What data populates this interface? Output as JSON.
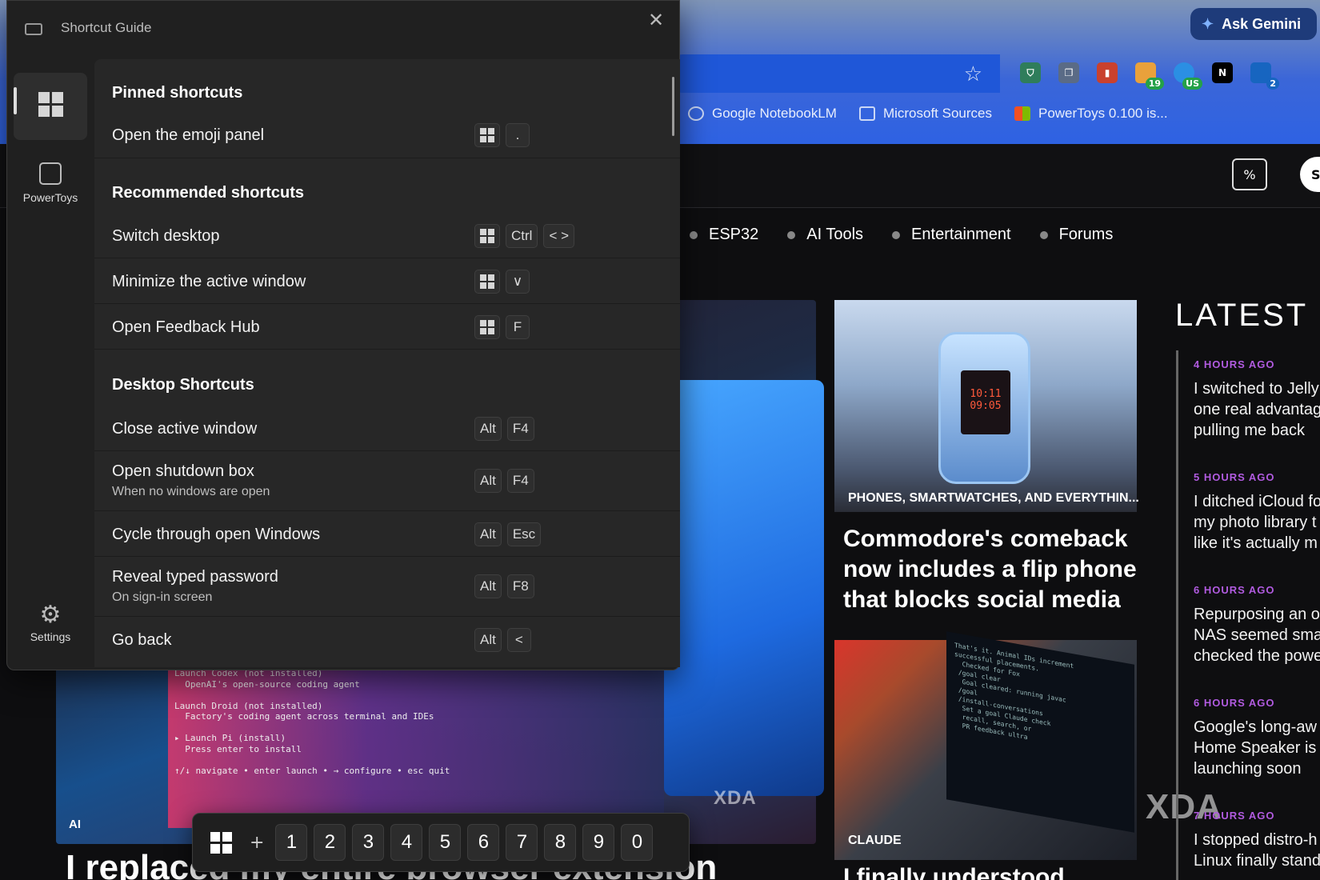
{
  "browser": {
    "ask_gemini": "Ask Gemini",
    "bookmarks": [
      "Google NotebookLM",
      "Microsoft Sources",
      "PowerToys 0.100 is..."
    ],
    "extension_badges": [
      "19",
      "US",
      "N",
      "2"
    ]
  },
  "site": {
    "nav": [
      "ESP32",
      "AI Tools",
      "Entertainment",
      "Forums"
    ],
    "signin_partial": "Si",
    "hero_tag": "AI",
    "hero_headline": "I replaced my entire browser extension",
    "terminal_lines": "Launch Codex (not installed)\n  OpenAI's open-source coding agent\n\nLaunch Droid (not installed)\n  Factory's coding agent across terminal and IDEs\n\n▸ Launch Pi (install)\n  Press enter to install\n\n↑/↓ navigate • enter launch • → configure • esc quit",
    "watermark": "XDA",
    "card1": {
      "tag": "PHONES, SMARTWATCHES, AND EVERYTHIN...",
      "title": "Commodore's comeback now includes a flip phone that blocks social media",
      "screen_text": "10:11 09:05"
    },
    "card2": {
      "tag": "CLAUDE",
      "title": "I finally understood"
    },
    "latest": {
      "title": "LATEST",
      "items": [
        {
          "time": "4 HOURS AGO",
          "text": "I switched to Jelly\none real advantag\npulling me back"
        },
        {
          "time": "5 HOURS AGO",
          "text": "I ditched iCloud fo\nmy photo library t\nlike it's actually m"
        },
        {
          "time": "6 HOURS AGO",
          "text": "Repurposing an o\nNAS seemed sma\nchecked the powe"
        },
        {
          "time": "6 HOURS AGO",
          "text": "Google's long-aw\nHome Speaker is\nlaunching soon"
        },
        {
          "time": "7 HOURS AGO",
          "text": "I stopped distro-h\nLinux finally stand"
        }
      ]
    }
  },
  "guide": {
    "title": "Shortcut Guide",
    "rail": {
      "powertoys": "PowerToys",
      "settings": "Settings"
    },
    "sections": {
      "pinned": "Pinned shortcuts",
      "recommended": "Recommended shortcuts",
      "desktop": "Desktop Shortcuts"
    },
    "rows": {
      "emoji": {
        "label": "Open the emoji panel",
        "keys": [
          "."
        ]
      },
      "switch_desktop": {
        "label": "Switch desktop",
        "keys": [
          "Ctrl",
          "<  >"
        ]
      },
      "minimize": {
        "label": "Minimize the active window",
        "keys": [
          "∨"
        ]
      },
      "feedback": {
        "label": "Open Feedback Hub",
        "keys": [
          "F"
        ]
      },
      "close_window": {
        "label": "Close active window",
        "keys": [
          "Alt",
          "F4"
        ]
      },
      "shutdown": {
        "label": "Open shutdown box",
        "sub": "When no windows are open",
        "keys": [
          "Alt",
          "F4"
        ]
      },
      "cycle": {
        "label": "Cycle through open Windows",
        "keys": [
          "Alt",
          "Esc"
        ]
      },
      "reveal": {
        "label": "Reveal typed password",
        "sub": "On sign-in screen",
        "keys": [
          "Alt",
          "F8"
        ]
      },
      "back": {
        "label": "Go back",
        "keys": [
          "Alt",
          "<"
        ]
      }
    }
  },
  "numbar": {
    "plus": "+",
    "digits": [
      "1",
      "2",
      "3",
      "4",
      "5",
      "6",
      "7",
      "8",
      "9",
      "0"
    ]
  }
}
